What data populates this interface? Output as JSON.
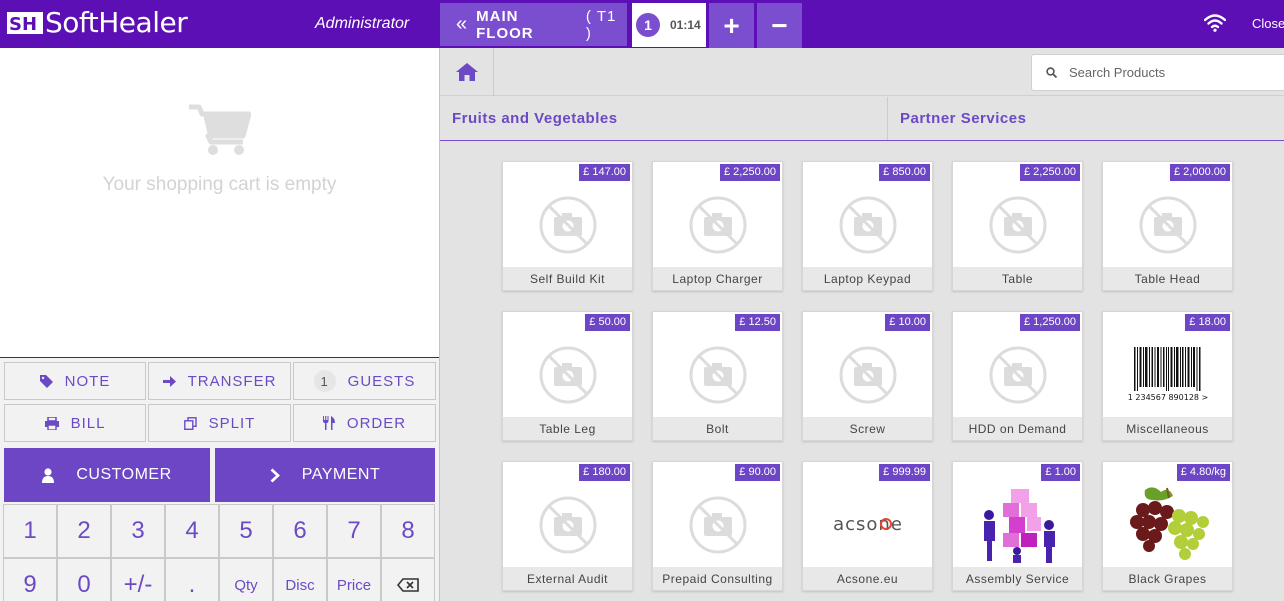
{
  "header": {
    "logo_text": "SoftHealer",
    "user": "Administrator",
    "floor_label": "MAIN FLOOR",
    "table_label": "( T1 )",
    "order_number": "1",
    "order_time": "01:14",
    "add_label": "+",
    "remove_label": "−",
    "close_label": "Close",
    "icons": {
      "floor_back": "double-chevron-left-icon",
      "wifi": "wifi-icon"
    }
  },
  "cart": {
    "empty_text": "Your shopping cart is empty",
    "icon": "shopping-cart-icon"
  },
  "controls": {
    "note": "NOTE",
    "transfer": "TRANSFER",
    "guests_count": "1",
    "guests": "GUESTS",
    "bill": "BILL",
    "split": "SPLIT",
    "order": "ORDER",
    "customer": "CUSTOMER",
    "payment": "PAYMENT"
  },
  "numpad": {
    "row1": [
      "1",
      "2",
      "3",
      "4",
      "5",
      "6",
      "7",
      "8"
    ],
    "row2": [
      "9",
      "0",
      "+/-",
      ".",
      "Qty",
      "Disc",
      "Price",
      "⌫"
    ]
  },
  "products_panel": {
    "search_placeholder": "Search Products",
    "categories": [
      "Fruits and Vegetables",
      "Partner Services"
    ],
    "products": [
      {
        "name": "Self Build Kit",
        "price": "£ 147.00"
      },
      {
        "name": "Laptop Charger",
        "price": "£ 2,250.00"
      },
      {
        "name": "Laptop Keypad",
        "price": "£ 850.00"
      },
      {
        "name": "Table",
        "price": "£ 2,250.00"
      },
      {
        "name": "Table Head",
        "price": "£ 2,000.00"
      },
      {
        "name": "Table Leg",
        "price": "£ 50.00"
      },
      {
        "name": "Bolt",
        "price": "£ 12.50"
      },
      {
        "name": "Screw",
        "price": "£ 10.00"
      },
      {
        "name": "HDD on Demand",
        "price": "£ 1,250.00"
      },
      {
        "name": "Miscellaneous",
        "price": "£ 18.00",
        "barcode_text": "1 234567 890128 >"
      },
      {
        "name": "External Audit",
        "price": "£ 180.00"
      },
      {
        "name": "Prepaid Consulting",
        "price": "£ 90.00"
      },
      {
        "name": "Acsone.eu",
        "price": "£ 999.99",
        "logo_text": "acsone"
      },
      {
        "name": "Assembly Service",
        "price": "£ 1.00"
      },
      {
        "name": "Black Grapes",
        "price": "£ 4.80/kg"
      }
    ]
  },
  "colors": {
    "brand": "#5c0fb5",
    "accent": "#6d46c6",
    "button_light": "#7b4ed0"
  }
}
